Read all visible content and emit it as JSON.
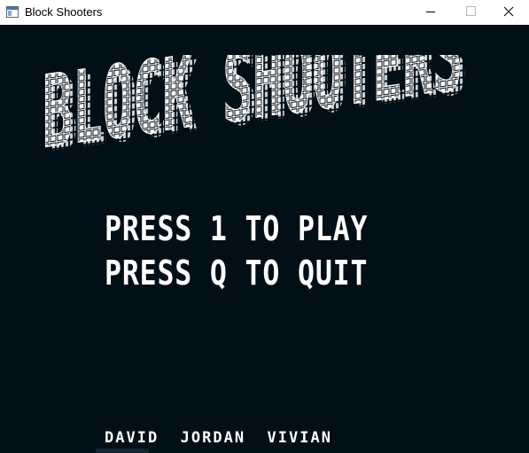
{
  "window": {
    "title": "Block Shooters",
    "icon": "app-window-icon",
    "controls": [
      "minimize-icon",
      "maximize-icon",
      "close-icon"
    ]
  },
  "game": {
    "logo_text": "BLOCK SHOOTERS",
    "menu": {
      "play": "PRESS 1 TO PLAY",
      "quit": "PRESS Q TO QUIT"
    },
    "credits": "DAVID  JORDAN  VIVIAN"
  },
  "colors": {
    "background": "#030f16",
    "text": "#ffffff"
  }
}
